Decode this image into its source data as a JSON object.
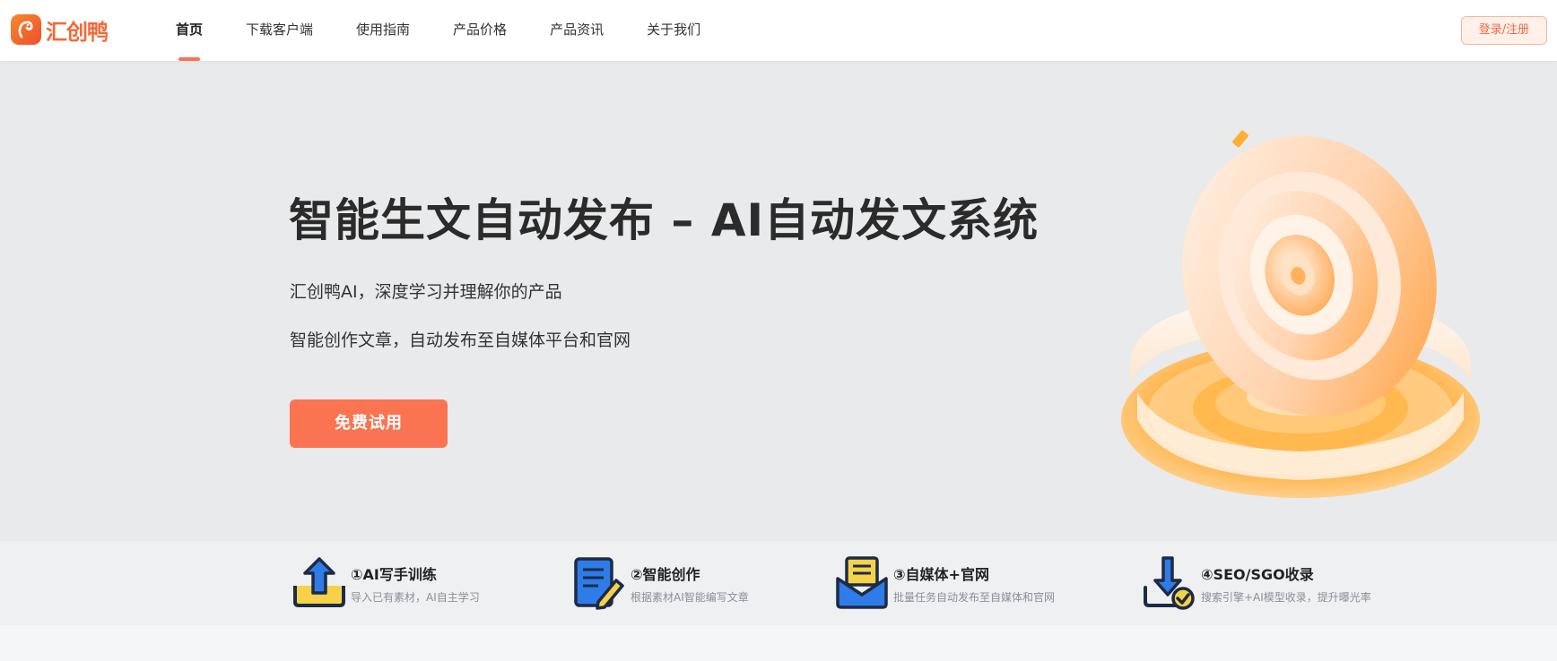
{
  "brand": {
    "name": "汇创鸭",
    "accent": "#f57452"
  },
  "nav": {
    "items": [
      {
        "label": "首页",
        "active": true
      },
      {
        "label": "下载客户端"
      },
      {
        "label": "使用指南"
      },
      {
        "label": "产品价格"
      },
      {
        "label": "产品资讯"
      },
      {
        "label": "关于我们"
      }
    ],
    "login_label": "登录/注册"
  },
  "hero": {
    "title": "智能生文自动发布 – AI自动发文系统",
    "line1": "汇创鸭AI，深度学习并理解你的产品",
    "line2": "智能创作文章，自动发布至自媒体平台和官网",
    "cta_label": "免费试用"
  },
  "features": [
    {
      "title": "①AI写手训练",
      "desc": "导入已有素材，AI自主学习",
      "icon": "upload-tray-icon"
    },
    {
      "title": "②智能创作",
      "desc": "根据素材AI智能编写文章",
      "icon": "document-pen-icon"
    },
    {
      "title": "③自媒体+官网",
      "desc": "批量任务自动发布至自媒体和官网",
      "icon": "envelope-icon"
    },
    {
      "title": "④SEO/SGO收录",
      "desc": "搜索引擎+AI模型收录，提升曝光率",
      "icon": "download-check-icon"
    }
  ]
}
